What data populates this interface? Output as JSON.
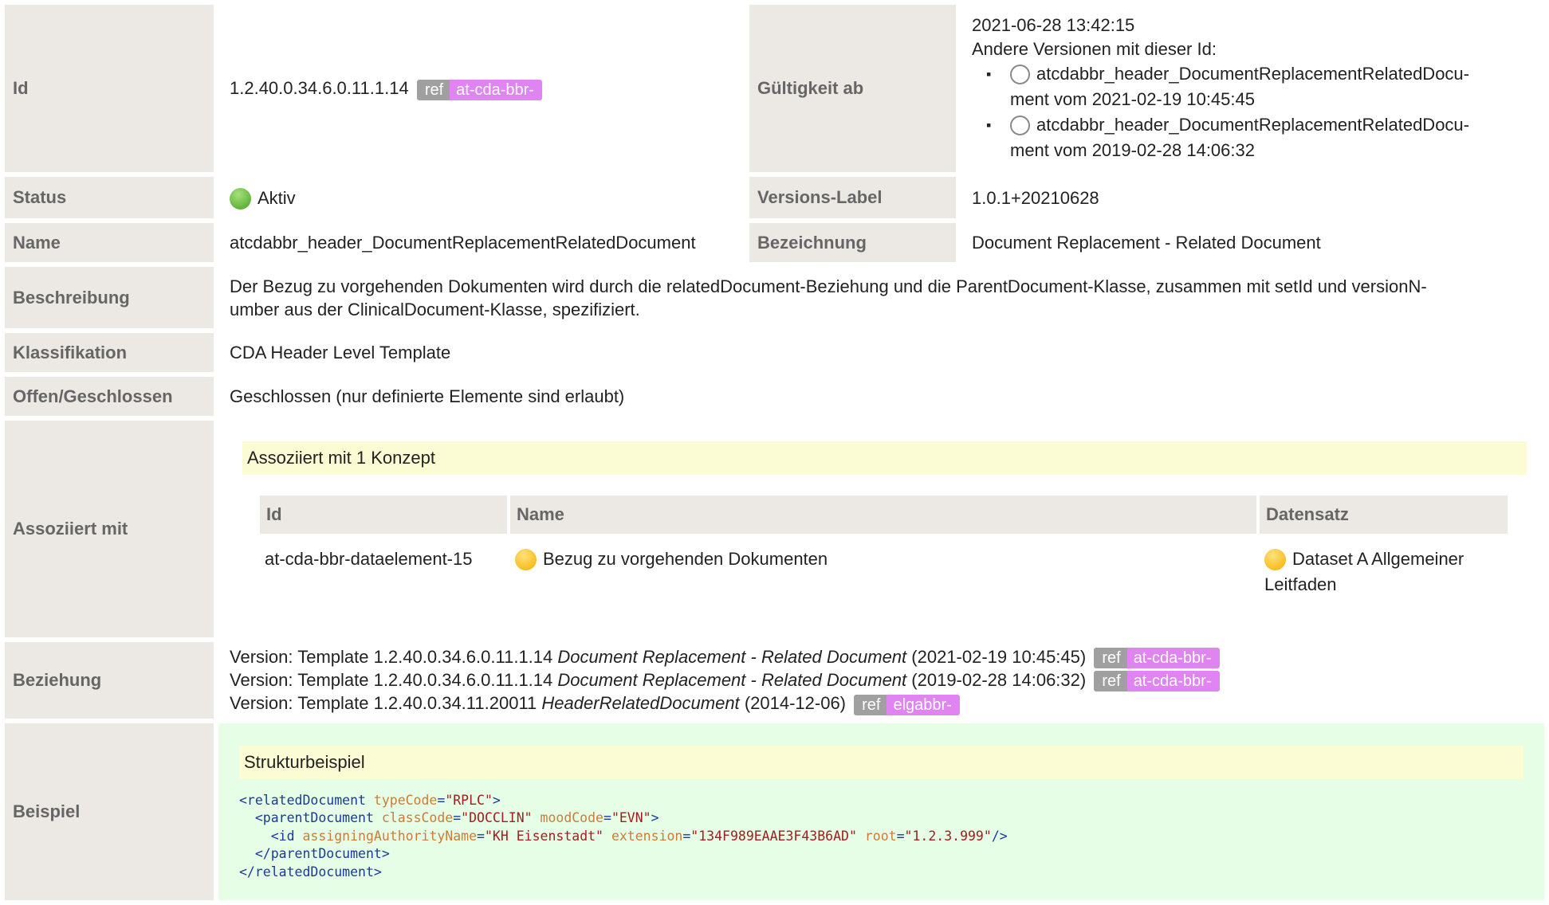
{
  "rows": {
    "id": {
      "label": "Id",
      "value": "1.2.40.0.34.6.0.11.1.14",
      "ref_prefix": "ref",
      "ref_name": "at-cda-bbr-"
    },
    "validity": {
      "label": "Gültigkeit ab",
      "date": "2021-06-28 13:42:15",
      "other_versions_label": "Andere Versionen mit dieser Id:",
      "versions": [
        {
          "name": "atcdabbr_header_DocumentReplacementRelatedDocu-",
          "rest": "ment vom 2021-02-19 10:45:45"
        },
        {
          "name": "atcdabbr_header_DocumentReplacementRelatedDocu-",
          "rest": "ment vom 2019-02-28 14:06:32"
        }
      ]
    },
    "status": {
      "label": "Status",
      "value": "Aktiv"
    },
    "version_label": {
      "label": "Versions-Label",
      "value": "1.0.1+20210628"
    },
    "name": {
      "label": "Name",
      "value": "atcdabbr_header_DocumentReplacementRelatedDocument"
    },
    "designation": {
      "label": "Bezeichnung",
      "value": "Document Replacement - Related Document"
    },
    "description": {
      "label": "Beschreibung",
      "line1": "Der Bezug zu vorgehenden Dokumenten wird durch die relatedDocument-Beziehung und die ParentDocument-Klasse, zusammen mit setId und versionN-",
      "line2": "umber aus der ClinicalDocument-Klasse, spezifiziert."
    },
    "classification": {
      "label": "Klassifikation",
      "value": "CDA Header Level Template"
    },
    "open_closed": {
      "label": "Offen/Geschlossen",
      "value": "Geschlossen (nur definierte Elemente sind erlaubt)"
    },
    "associated": {
      "label": "Assoziiert mit",
      "heading": "Assoziiert mit 1 Konzept",
      "columns": [
        "Id",
        "Name",
        "Datensatz"
      ],
      "row": {
        "id": "at-cda-bbr-dataelement-15",
        "name": "Bezug zu vorgehenden Dokumenten",
        "dataset": "Dataset A Allgemeiner Leitfaden"
      }
    },
    "relationship": {
      "label": "Beziehung",
      "items": [
        {
          "prefix": "Version: Template 1.2.40.0.34.6.0.11.1.14",
          "title": "Document Replacement - Related Document",
          "date": "(2021-02-19 10:45:45)",
          "ref_prefix": "ref",
          "ref_name": "at-cda-bbr-"
        },
        {
          "prefix": "Version: Template 1.2.40.0.34.6.0.11.1.14",
          "title": "Document Replacement - Related Document",
          "date": "(2019-02-28 14:06:32)",
          "ref_prefix": "ref",
          "ref_name": "at-cda-bbr-"
        },
        {
          "prefix": "Version: Template 1.2.40.0.34.11.20011",
          "title": "HeaderRelatedDocument",
          "date": "(2014-12-06)",
          "ref_prefix": "ref",
          "ref_name": "elgabbr-"
        }
      ]
    },
    "example": {
      "label": "Beispiel",
      "heading": "Strukturbeispiel",
      "code": {
        "l1_tag": "<relatedDocument",
        "l1_attr": "typeCode",
        "l1_val": "\"RPLC\"",
        "l1_end": ">",
        "l2_tag": "<parentDocument",
        "l2_attr1": "classCode",
        "l2_val1": "\"DOCCLIN\"",
        "l2_attr2": "moodCode",
        "l2_val2": "\"EVN\"",
        "l2_end": ">",
        "l3_tag": "<id",
        "l3_attr1": "assigningAuthorityName",
        "l3_val1": "\"KH Eisenstadt\"",
        "l3_attr2": "extension",
        "l3_val2": "\"134F989EAAE3F43B6AD\"",
        "l3_attr3": "root",
        "l3_val3": "\"1.2.3.999\"",
        "l3_end": "/>",
        "l4": "</parentDocument>",
        "l5": "</relatedDocument>"
      }
    }
  }
}
